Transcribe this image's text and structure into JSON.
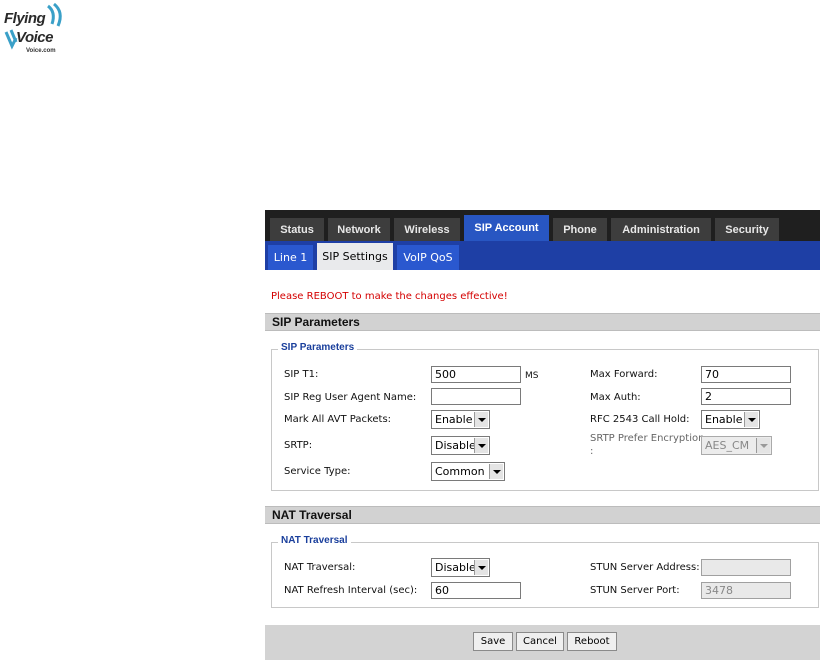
{
  "logo": {
    "line1": "Flying",
    "line2": "Voice",
    "line3": "Voice.com"
  },
  "nav": {
    "tabs": [
      "Status",
      "Network",
      "Wireless",
      "SIP Account",
      "Phone",
      "Administration",
      "Security"
    ],
    "active": "SIP Account"
  },
  "subnav": {
    "tabs": [
      "Line 1",
      "SIP Settings",
      "VoIP QoS"
    ],
    "active": "SIP Settings"
  },
  "reboot_message": "Please REBOOT to make the changes effective!",
  "sip": {
    "section_title": "SIP Parameters",
    "legend": "SIP Parameters",
    "t1_label": "SIP T1:",
    "t1_value": "500",
    "t1_unit": "MS",
    "ua_label": "SIP Reg User Agent Name:",
    "ua_value": "",
    "avt_label": "Mark All AVT Packets:",
    "avt_value": "Enable",
    "srtp_label": "SRTP:",
    "srtp_value": "Disable",
    "service_label": "Service Type:",
    "service_value": "Common",
    "max_forward_label": "Max Forward:",
    "max_forward_value": "70",
    "max_auth_label": "Max Auth:",
    "max_auth_value": "2",
    "rfc_label": "RFC 2543 Call Hold:",
    "rfc_value": "Enable",
    "srtp_pref_label": "SRTP Prefer Encryption",
    "srtp_pref_colon": ":",
    "srtp_pref_value": "AES_CM"
  },
  "nat": {
    "section_title": "NAT Traversal",
    "legend": "NAT Traversal",
    "traversal_label": "NAT Traversal:",
    "traversal_value": "Disable",
    "refresh_label": "NAT Refresh Interval (sec):",
    "refresh_value": "60",
    "stun_addr_label": "STUN Server Address:",
    "stun_addr_value": "",
    "stun_port_label": "STUN Server Port:",
    "stun_port_value": "3478"
  },
  "buttons": {
    "save": "Save",
    "cancel": "Cancel",
    "reboot": "Reboot"
  }
}
